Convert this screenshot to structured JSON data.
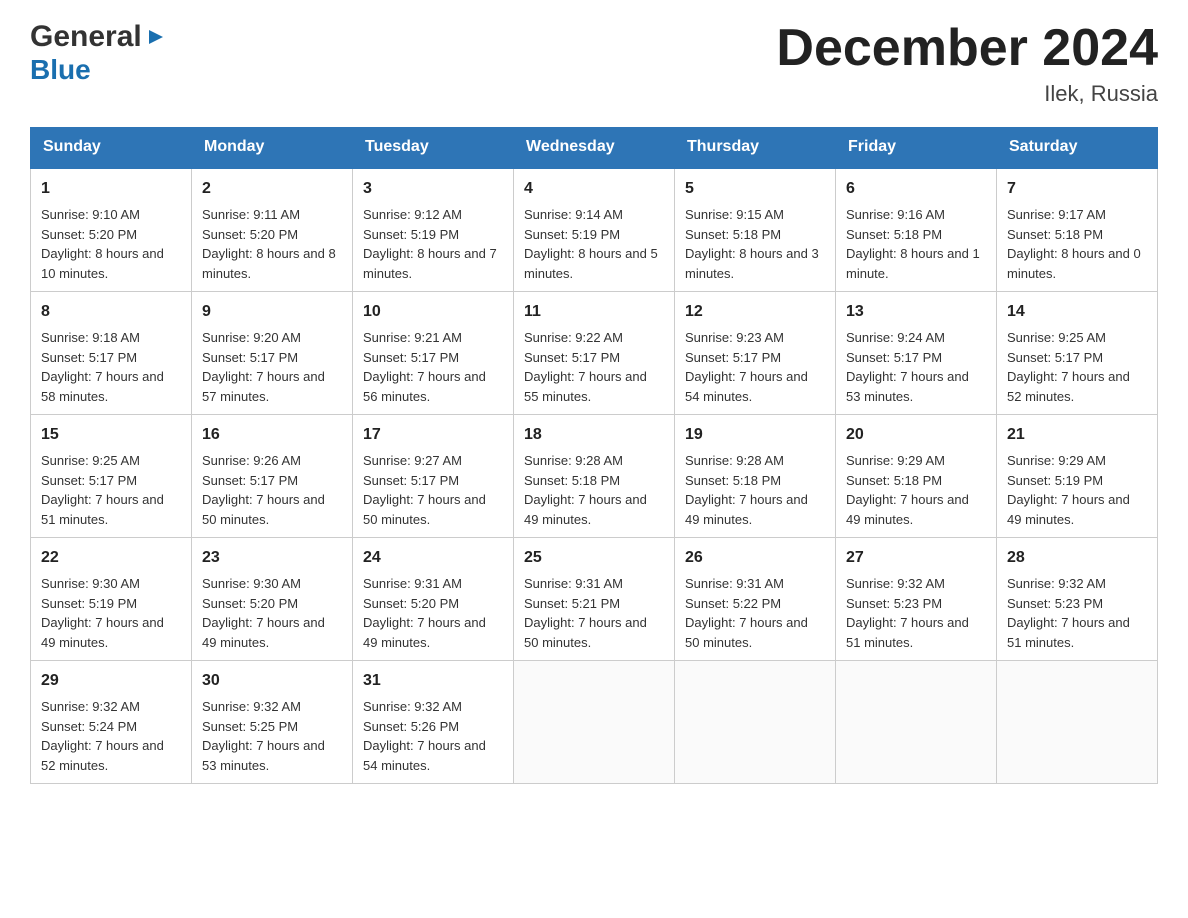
{
  "header": {
    "logo_general": "General",
    "logo_blue": "Blue",
    "month_title": "December 2024",
    "location": "Ilek, Russia"
  },
  "days_of_week": [
    "Sunday",
    "Monday",
    "Tuesday",
    "Wednesday",
    "Thursday",
    "Friday",
    "Saturday"
  ],
  "weeks": [
    [
      {
        "day": "1",
        "sunrise": "9:10 AM",
        "sunset": "5:20 PM",
        "daylight": "8 hours and 10 minutes."
      },
      {
        "day": "2",
        "sunrise": "9:11 AM",
        "sunset": "5:20 PM",
        "daylight": "8 hours and 8 minutes."
      },
      {
        "day": "3",
        "sunrise": "9:12 AM",
        "sunset": "5:19 PM",
        "daylight": "8 hours and 7 minutes."
      },
      {
        "day": "4",
        "sunrise": "9:14 AM",
        "sunset": "5:19 PM",
        "daylight": "8 hours and 5 minutes."
      },
      {
        "day": "5",
        "sunrise": "9:15 AM",
        "sunset": "5:18 PM",
        "daylight": "8 hours and 3 minutes."
      },
      {
        "day": "6",
        "sunrise": "9:16 AM",
        "sunset": "5:18 PM",
        "daylight": "8 hours and 1 minute."
      },
      {
        "day": "7",
        "sunrise": "9:17 AM",
        "sunset": "5:18 PM",
        "daylight": "8 hours and 0 minutes."
      }
    ],
    [
      {
        "day": "8",
        "sunrise": "9:18 AM",
        "sunset": "5:17 PM",
        "daylight": "7 hours and 58 minutes."
      },
      {
        "day": "9",
        "sunrise": "9:20 AM",
        "sunset": "5:17 PM",
        "daylight": "7 hours and 57 minutes."
      },
      {
        "day": "10",
        "sunrise": "9:21 AM",
        "sunset": "5:17 PM",
        "daylight": "7 hours and 56 minutes."
      },
      {
        "day": "11",
        "sunrise": "9:22 AM",
        "sunset": "5:17 PM",
        "daylight": "7 hours and 55 minutes."
      },
      {
        "day": "12",
        "sunrise": "9:23 AM",
        "sunset": "5:17 PM",
        "daylight": "7 hours and 54 minutes."
      },
      {
        "day": "13",
        "sunrise": "9:24 AM",
        "sunset": "5:17 PM",
        "daylight": "7 hours and 53 minutes."
      },
      {
        "day": "14",
        "sunrise": "9:25 AM",
        "sunset": "5:17 PM",
        "daylight": "7 hours and 52 minutes."
      }
    ],
    [
      {
        "day": "15",
        "sunrise": "9:25 AM",
        "sunset": "5:17 PM",
        "daylight": "7 hours and 51 minutes."
      },
      {
        "day": "16",
        "sunrise": "9:26 AM",
        "sunset": "5:17 PM",
        "daylight": "7 hours and 50 minutes."
      },
      {
        "day": "17",
        "sunrise": "9:27 AM",
        "sunset": "5:17 PM",
        "daylight": "7 hours and 50 minutes."
      },
      {
        "day": "18",
        "sunrise": "9:28 AM",
        "sunset": "5:18 PM",
        "daylight": "7 hours and 49 minutes."
      },
      {
        "day": "19",
        "sunrise": "9:28 AM",
        "sunset": "5:18 PM",
        "daylight": "7 hours and 49 minutes."
      },
      {
        "day": "20",
        "sunrise": "9:29 AM",
        "sunset": "5:18 PM",
        "daylight": "7 hours and 49 minutes."
      },
      {
        "day": "21",
        "sunrise": "9:29 AM",
        "sunset": "5:19 PM",
        "daylight": "7 hours and 49 minutes."
      }
    ],
    [
      {
        "day": "22",
        "sunrise": "9:30 AM",
        "sunset": "5:19 PM",
        "daylight": "7 hours and 49 minutes."
      },
      {
        "day": "23",
        "sunrise": "9:30 AM",
        "sunset": "5:20 PM",
        "daylight": "7 hours and 49 minutes."
      },
      {
        "day": "24",
        "sunrise": "9:31 AM",
        "sunset": "5:20 PM",
        "daylight": "7 hours and 49 minutes."
      },
      {
        "day": "25",
        "sunrise": "9:31 AM",
        "sunset": "5:21 PM",
        "daylight": "7 hours and 50 minutes."
      },
      {
        "day": "26",
        "sunrise": "9:31 AM",
        "sunset": "5:22 PM",
        "daylight": "7 hours and 50 minutes."
      },
      {
        "day": "27",
        "sunrise": "9:32 AM",
        "sunset": "5:23 PM",
        "daylight": "7 hours and 51 minutes."
      },
      {
        "day": "28",
        "sunrise": "9:32 AM",
        "sunset": "5:23 PM",
        "daylight": "7 hours and 51 minutes."
      }
    ],
    [
      {
        "day": "29",
        "sunrise": "9:32 AM",
        "sunset": "5:24 PM",
        "daylight": "7 hours and 52 minutes."
      },
      {
        "day": "30",
        "sunrise": "9:32 AM",
        "sunset": "5:25 PM",
        "daylight": "7 hours and 53 minutes."
      },
      {
        "day": "31",
        "sunrise": "9:32 AM",
        "sunset": "5:26 PM",
        "daylight": "7 hours and 54 minutes."
      },
      null,
      null,
      null,
      null
    ]
  ],
  "labels": {
    "sunrise": "Sunrise: ",
    "sunset": "Sunset: ",
    "daylight": "Daylight: "
  }
}
